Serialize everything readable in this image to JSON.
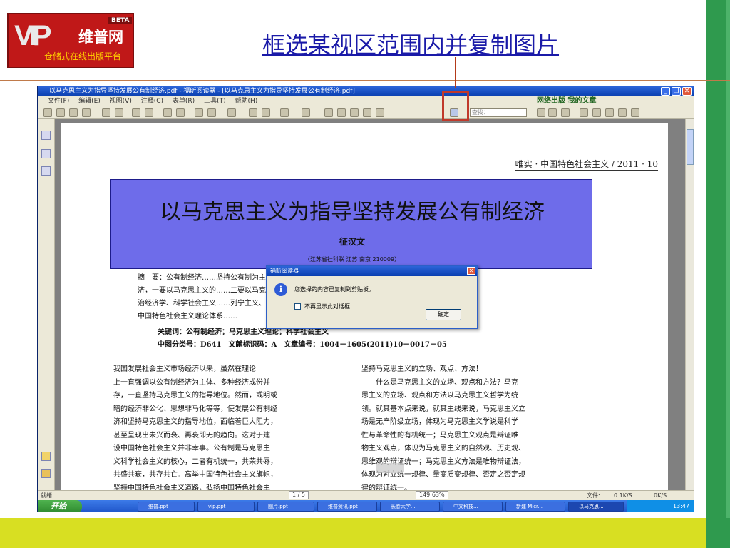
{
  "slide": {
    "title": "框选某视区范围内并复制图片",
    "logo": {
      "beta": "BETA",
      "mark": "VIP",
      "name": "维普网",
      "subtitle": "仓储式在线出版平台"
    },
    "colors": {
      "accent_green": "#2f9a4e",
      "bottom_yellow": "#d8df22",
      "title_blue": "#1a1aa8",
      "highlight_red": "#c0392b"
    }
  },
  "window": {
    "title": "以马克思主义为指导坚持发展公有制经济.pdf - 福昕阅读器 - [以马克思主义为指导坚持发展公有制经济.pdf]",
    "menu": [
      "文件(F)",
      "编辑(E)",
      "视图(V)",
      "注释(C)",
      "表单(R)",
      "工具(T)",
      "帮助(H)"
    ],
    "menu_right": "网络出版 我的文章",
    "search_placeholder": "查找：",
    "status": {
      "left": "就绪",
      "page": "1 / 5",
      "zoom": "149.63%",
      "right": "文件:",
      "speed_up": "0.1K/S",
      "speed_down": "0K/S"
    }
  },
  "document": {
    "journal": "唯实 · 中国特色社会主义 / 2011 · 10",
    "article_title": "以马克思主义为指导坚持发展公有制经济",
    "author": "征汉文",
    "affiliation": "（江苏省社科联 江苏 南京 210009）",
    "abstract": [
      "摘　要：公有制经济……坚持公有制为主体……新时期发展公有制经",
      "济，一要以马克思主义的……二要以马克思主义哲学、政",
      "治经济学、科学社会主义……列宁主义、毛泽东思想、",
      "中国特色社会主义理论体系……"
    ],
    "keywords": "关键词：公有制经济；马克思主义理论；科学社会主义",
    "classification": "中图分类号：D641　文献标识码：A　文章编号：1004－1605(2011)10－0017－05",
    "col_left": [
      "我国发展社会主义市场经济以来，虽然在理论",
      "上一直强调以公有制经济为主体、多种经济成份并",
      "存，一直坚持马克思主义的指导地位。然而，或明或",
      "暗的经济非公化、思想非马化等等，使发展公有制经",
      "济和坚持马克思主义的指导地位，面临着巨大阻力，",
      "甚至呈现出未兴而衰、再衰即无的趋向。这对于建",
      "设中国特色社会主义并非幸事。公有制是马克思主",
      "义科学社会主义的核心，二者有机统一，共荣共辱，",
      "共盛共衰，共存共亡。高举中国特色社会主义旗帜，",
      "坚持中国特色社会主义道路，弘扬中国特色社会主"
    ],
    "col_right": [
      "坚持马克思主义的立场、观点、方法！",
      "　　什么是马克思主义的立场、观点和方法？马克",
      "思主义的立场、观点和方法以马克思主义哲学为统",
      "领。就其基本点来说，就其主线来说，马克思主义立",
      "场是无产阶级立场，体现为马克思主义学说是科学",
      "性与革命性的有机统一；马克思主义观点是辩证唯",
      "物主义观点，体现为马克思主义的自然观、历史观、",
      "思维观的辩证统一；马克思主义方法是唯物辩证法，",
      "体现为对立统一规律、量变质变规律、否定之否定规",
      "律的辩证统一。"
    ]
  },
  "dialog": {
    "title": "福昕阅读器",
    "message": "您选择的内容已复制到剪贴板。",
    "checkbox_label": "不再显示此对话框",
    "ok_label": "确定",
    "close_glyph": "✕",
    "icon_glyph": "i"
  },
  "taskbar": {
    "start": "开始",
    "buttons": [
      "维普.ppt",
      "vip.ppt",
      "图片.ppt",
      "维普资讯.ppt",
      "长春大学...",
      "中文科技...",
      "新建 Micr...",
      "以马克思..."
    ],
    "clock": "13:47"
  }
}
